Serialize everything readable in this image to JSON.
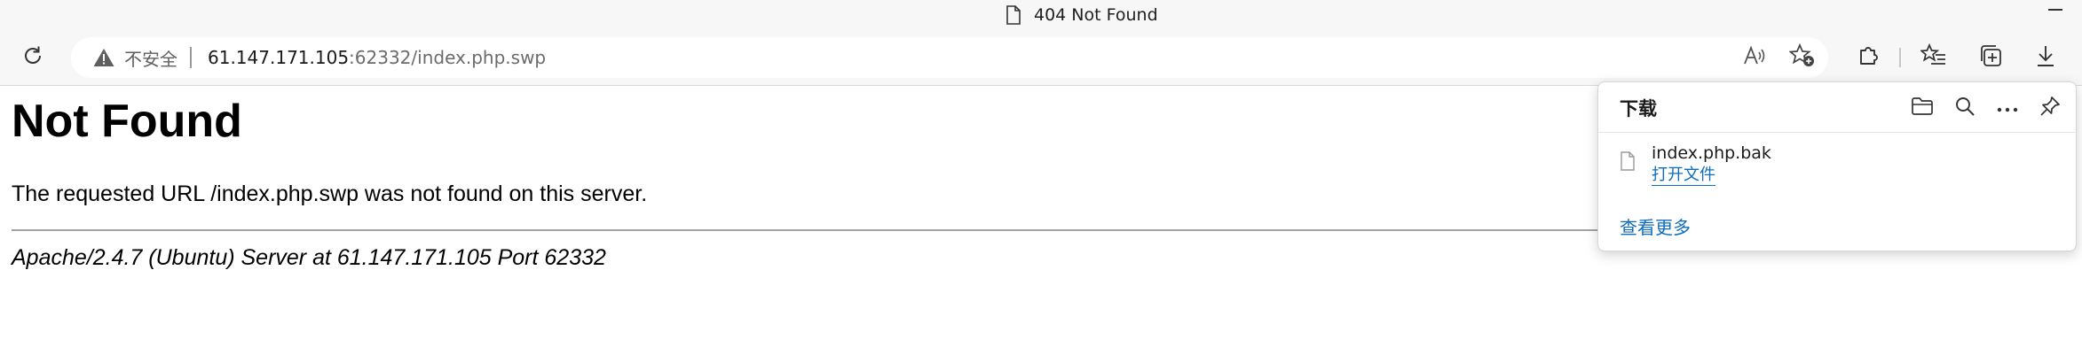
{
  "window": {
    "title": "404 Not Found"
  },
  "toolbar": {
    "security_label": "不安全",
    "url_host": "61.147.171.105",
    "url_rest": ":62332/index.php.swp"
  },
  "page": {
    "heading": "Not Found",
    "message": "The requested URL /index.php.swp was not found on this server.",
    "server_signature": "Apache/2.4.7 (Ubuntu) Server at 61.147.171.105 Port 62332"
  },
  "downloads": {
    "title": "下载",
    "items": [
      {
        "filename": "index.php.bak",
        "action": "打开文件"
      }
    ],
    "see_more": "查看更多"
  },
  "colors": {
    "link": "#0f6cbd",
    "chrome_bg": "#f7f7f7"
  }
}
